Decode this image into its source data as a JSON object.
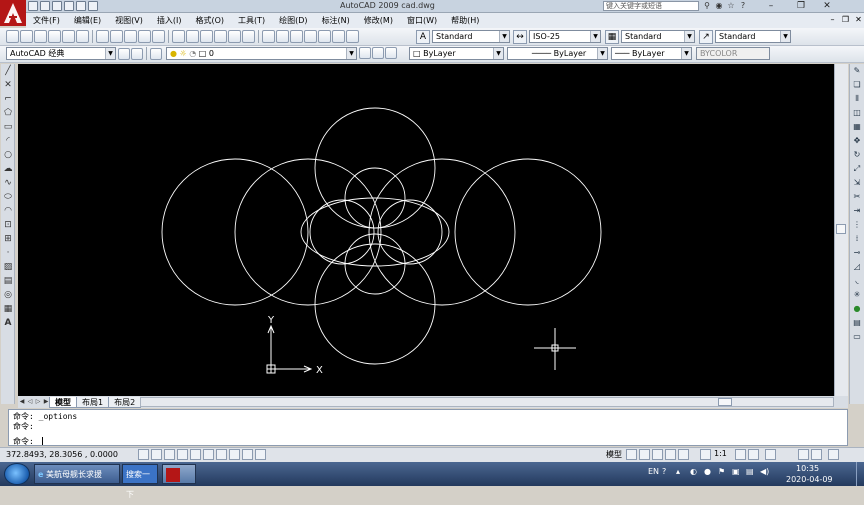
{
  "window": {
    "title": "AutoCAD 2009  cad.dwg",
    "search_placeholder": "键入关键字或短语"
  },
  "menu": [
    "文件(F)",
    "编辑(E)",
    "视图(V)",
    "插入(I)",
    "格式(O)",
    "工具(T)",
    "绘图(D)",
    "标注(N)",
    "修改(M)",
    "窗口(W)",
    "帮助(H)"
  ],
  "toolbar": {
    "text_style": "Standard",
    "dim_style": "ISO-25",
    "table_style": "Standard",
    "mleader_style": "Standard"
  },
  "toolbar2": {
    "workspace": "AutoCAD 经典",
    "layer": "0",
    "color": "ByLayer",
    "linetype": "ByLayer",
    "lineweight": "ByLayer",
    "plotstyle": "BYCOLOR"
  },
  "ucs": {
    "y_label": "Y",
    "x_label": "X"
  },
  "tabs": [
    "模型",
    "布局1",
    "布局2"
  ],
  "command": {
    "line1": "命令: _options",
    "line2": "命令:",
    "prompt": "命令:"
  },
  "status": {
    "coords": "372.8493,  28.3056 , 0.0000",
    "model_label": "模型",
    "scale": "1:1"
  },
  "taskbar": {
    "item1": "美航母舰长求援",
    "item2": "搜索一下",
    "lang": "EN",
    "time": "10:35",
    "date": "2020-04-09"
  },
  "colors": {
    "canvas": "#000000",
    "drawing": "#ffffff",
    "logo": "#b41616"
  },
  "icons": {
    "logo": "autocad-logo-icon",
    "start": "windows-start-icon",
    "ie": "internet-explorer-icon"
  }
}
